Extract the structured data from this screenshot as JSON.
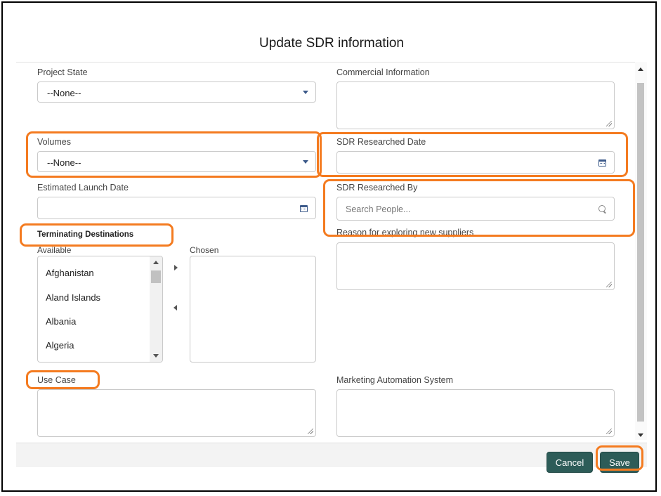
{
  "modal": {
    "title": "Update SDR information"
  },
  "fields": {
    "project_state": {
      "label": "Project State",
      "value": "--None--"
    },
    "commercial_information": {
      "label": "Commercial Information",
      "value": ""
    },
    "volumes": {
      "label": "Volumes",
      "value": "--None--"
    },
    "sdr_researched_date": {
      "label": "SDR Researched Date",
      "value": ""
    },
    "estimated_launch_date": {
      "label": "Estimated Launch Date",
      "value": ""
    },
    "sdr_researched_by": {
      "label": "SDR Researched By",
      "placeholder": "Search People..."
    },
    "reason_new_suppliers": {
      "label": "Reason for exploring new suppliers",
      "value": ""
    },
    "terminating_destinations": {
      "label": "Terminating Destinations",
      "available_label": "Available",
      "chosen_label": "Chosen",
      "available": [
        "Afghanistan",
        "Aland Islands",
        "Albania",
        "Algeria"
      ],
      "chosen": []
    },
    "use_case": {
      "label": "Use Case",
      "value": ""
    },
    "marketing_automation_system": {
      "label": "Marketing Automation System",
      "value": ""
    }
  },
  "footer": {
    "cancel_label": "Cancel",
    "save_label": "Save"
  },
  "icons": {
    "dropdown": "chevron-down-icon",
    "date": "calendar-icon",
    "search": "search-icon",
    "move_right": "arrow-right-icon",
    "move_left": "arrow-left-icon"
  },
  "colors": {
    "highlight": "#f47b20",
    "button": "#2d5c58",
    "icon": "#3c5a8a"
  }
}
